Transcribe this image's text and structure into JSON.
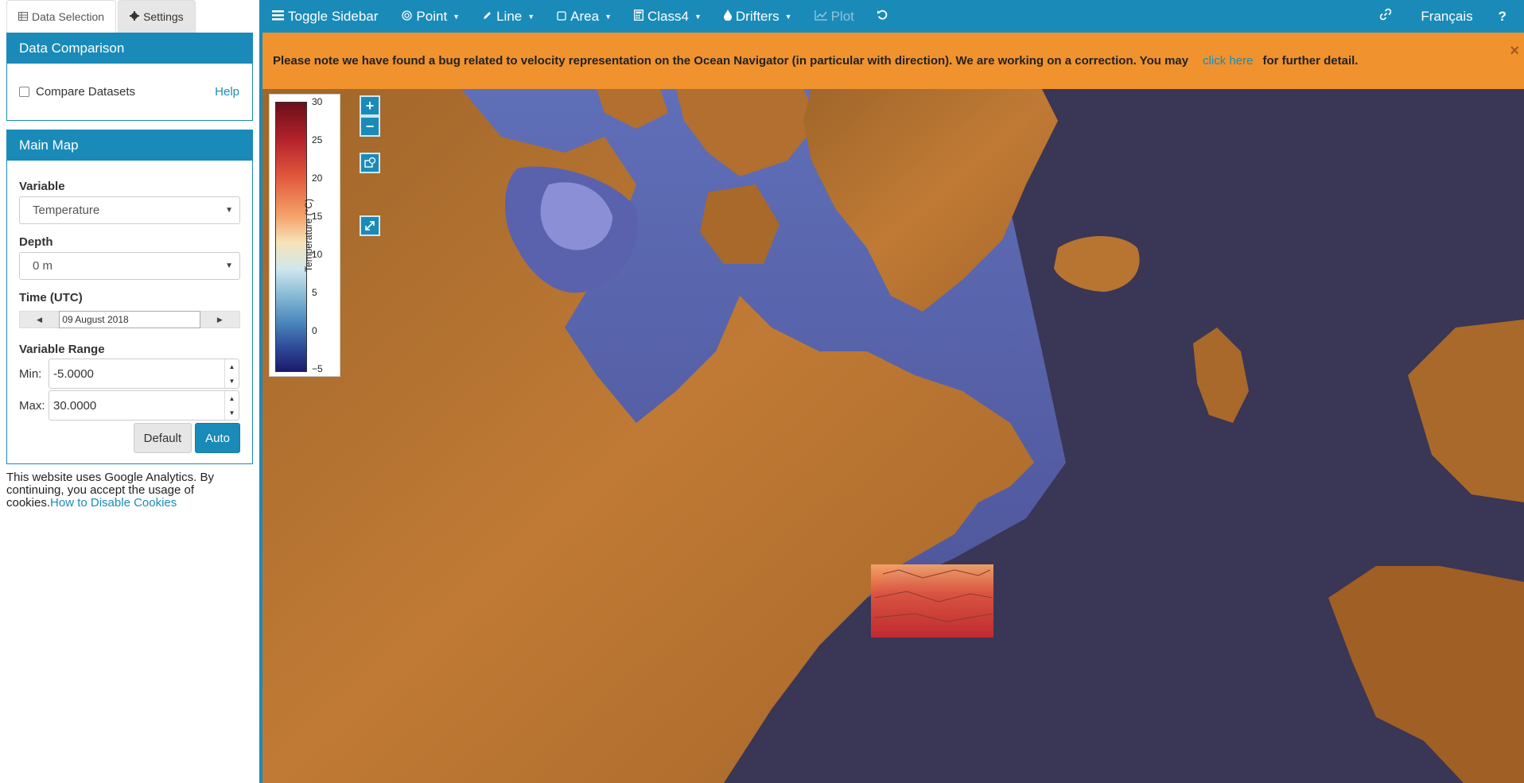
{
  "sidebar": {
    "tabs": [
      {
        "label": "Data Selection",
        "icon": "table-icon"
      },
      {
        "label": "Settings",
        "icon": "gear-icon"
      }
    ],
    "comparison": {
      "title": "Data Comparison",
      "checkbox_label": "Compare Datasets",
      "help": "Help"
    },
    "main_map": {
      "title": "Main Map",
      "variable_label": "Variable",
      "variable_value": "Temperature",
      "depth_label": "Depth",
      "depth_value": "0 m",
      "time_label": "Time (UTC)",
      "time_value": "09 August 2018",
      "range_label": "Variable Range",
      "min_label": "Min:",
      "min_value": "-5.0000",
      "max_label": "Max:",
      "max_value": "30.0000",
      "default_button": "Default",
      "auto_button": "Auto"
    },
    "cookie": {
      "text": "This website uses Google Analytics. By continuing, you accept the usage of cookies.",
      "link": "How to Disable Cookies"
    }
  },
  "topnav": {
    "toggle": "Toggle Sidebar",
    "point": "Point",
    "line": "Line",
    "area": "Area",
    "class4": "Class4",
    "drifters": "Drifters",
    "plot": "Plot",
    "language": "Français",
    "help": "?"
  },
  "banner": {
    "text": "Please note we have found a bug related to velocity representation on the Ocean Navigator (in particular with direction). We are working on a correction. You may",
    "link": "click here",
    "suffix": "for further detail.",
    "close": "×"
  },
  "map": {
    "zoom_in": "+",
    "zoom_out": "−",
    "colorbar": {
      "title": "Temperature (°C)",
      "ticks": [
        "30",
        "25",
        "20",
        "15",
        "10",
        "5",
        "0",
        "−5"
      ]
    }
  },
  "colors": {
    "accent": "#1a8bb8",
    "banner": "#f0922e",
    "ocean": "#3b3856",
    "land": "#b06f2a"
  }
}
